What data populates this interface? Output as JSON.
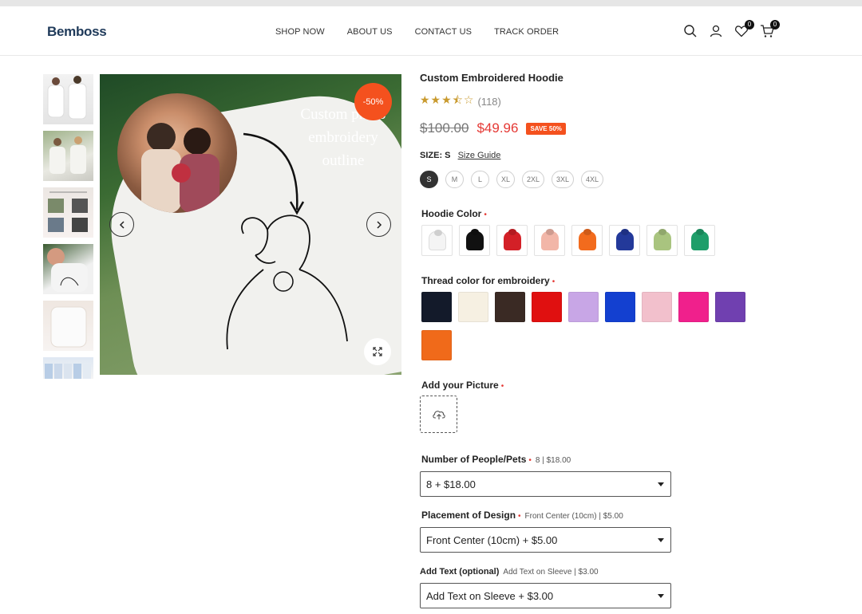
{
  "brand": {
    "logo": "Bemboss"
  },
  "nav": {
    "items": [
      "SHOP NOW",
      "ABOUT US",
      "CONTACT US",
      "TRACK ORDER"
    ]
  },
  "header": {
    "wishlist_count": "0",
    "cart_count": "0"
  },
  "gallery": {
    "overlay_text": "Custom photo embroidery outline",
    "discount_badge": "-50%"
  },
  "product": {
    "title": "Custom Embroidered Hoodie",
    "rating": 3.5,
    "rating_count": "(118)",
    "old_price": "$100.00",
    "new_price": "$49.96",
    "save_badge": "SAVE 50%",
    "size_label": "SIZE: S",
    "size_guide": "Size Guide",
    "sizes": [
      "S",
      "M",
      "L",
      "XL",
      "2XL",
      "3XL",
      "4XL"
    ],
    "selected_size": "S"
  },
  "hoodie_color": {
    "label": "Hoodie Color",
    "required": "•",
    "colors": [
      "#f4f4f4",
      "#111111",
      "#d32027",
      "#f2b6a8",
      "#f26b1d",
      "#23399a",
      "#a9c47f",
      "#1f9e6a"
    ]
  },
  "thread_color": {
    "label": "Thread color for embroidery",
    "required": "•",
    "colors": [
      "#131a2a",
      "#f6f0e2",
      "#3a2a24",
      "#e01010",
      "#c8a6e6",
      "#1340d0",
      "#f2c0cc",
      "#f0208c",
      "#7040b0",
      "#f06a1a"
    ]
  },
  "picture": {
    "label": "Add your Picture",
    "required": "•"
  },
  "people": {
    "label": "Number of People/Pets",
    "required": "•",
    "hint": "8 | $18.00",
    "value": "8  + $18.00"
  },
  "placement": {
    "label": "Placement of Design",
    "required": "•",
    "hint": "Front Center (10cm) | $5.00",
    "value": "Front Center (10cm)  + $5.00"
  },
  "add_text": {
    "label": "Add Text (optional)",
    "hint": "Add Text on Sleeve | $3.00",
    "value": "Add Text on Sleeve  + $3.00"
  }
}
